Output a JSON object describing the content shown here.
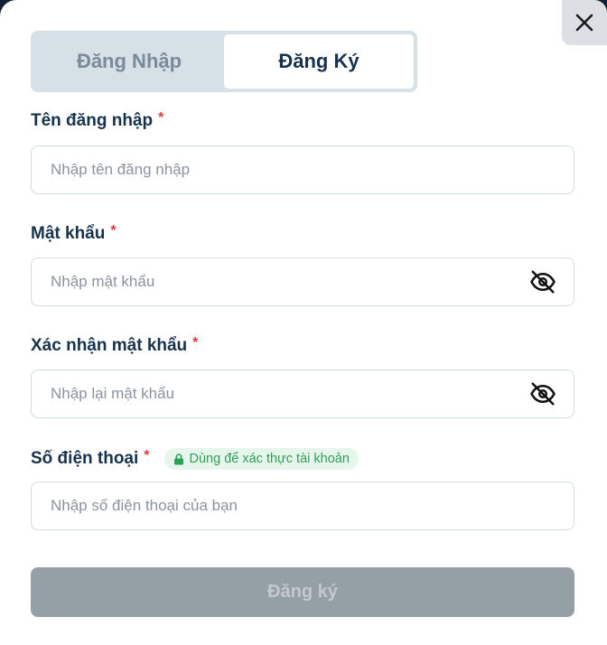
{
  "tabs": [
    {
      "label": "Đăng Nhập",
      "active": false
    },
    {
      "label": "Đăng Ký",
      "active": true
    }
  ],
  "form": {
    "username": {
      "label": "Tên đăng nhập",
      "required": "*",
      "placeholder": "Nhập tên đăng nhập"
    },
    "password": {
      "label": "Mật khẩu",
      "required": "*",
      "placeholder": "Nhập mật khẩu",
      "icon": "eye-off-icon"
    },
    "confirm_password": {
      "label": "Xác nhận mật khẩu",
      "required": "*",
      "placeholder": "Nhập lại mật khẩu",
      "icon": "eye-off-icon"
    },
    "phone": {
      "label": "Số điện thoại",
      "required": "*",
      "placeholder": "Nhập số điện thoại của bạn",
      "badge": "Dùng để xác thực tài khoản",
      "badge_icon": "lock-icon"
    }
  },
  "submit_label": "Đăng ký",
  "close_icon": "close-icon",
  "colors": {
    "primary_text": "#17324d",
    "required": "#e23a3a",
    "badge_text": "#2e9e55",
    "badge_bg": "#e6f6ec",
    "submit_disabled_bg": "#95a0a6"
  }
}
